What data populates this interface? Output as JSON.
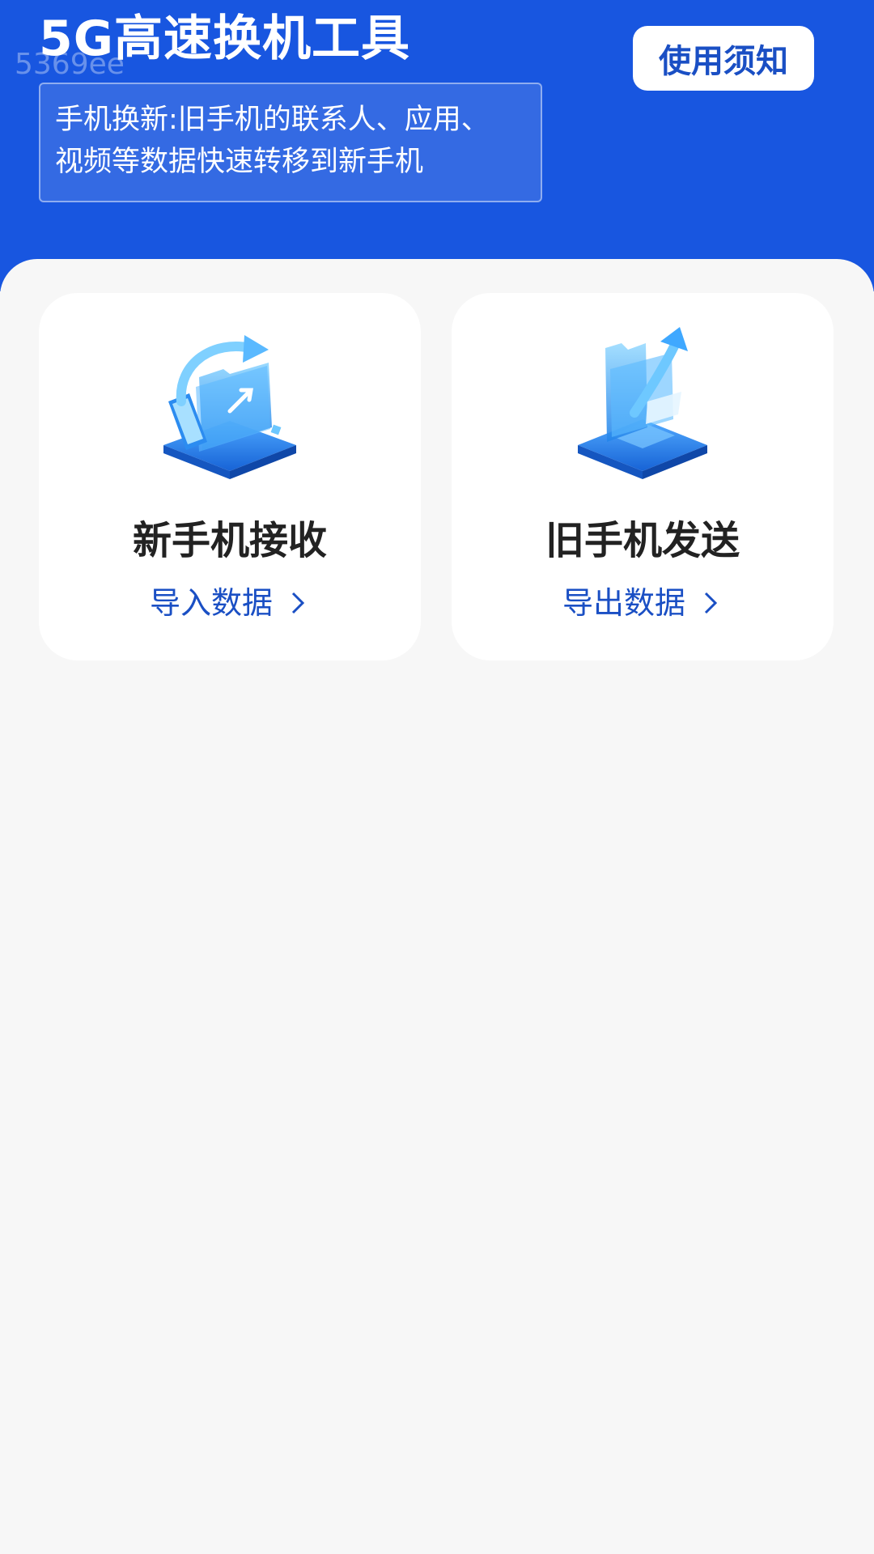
{
  "header": {
    "title": "5G高速换机工具",
    "watermark": "5369ee",
    "notice_button": "使用须知",
    "subtitle_lines": [
      "手机换新:旧手机的联系人、应用、",
      "视频等数据快速转移到新手机"
    ]
  },
  "cards": [
    {
      "title": "新手机接收",
      "action": "导入数据",
      "icon": "receive-data-illustration"
    },
    {
      "title": "旧手机发送",
      "action": "导出数据",
      "icon": "send-data-illustration"
    }
  ],
  "colors": {
    "header_bg": "#1856e0",
    "accent": "#1a4fc4",
    "page_bg": "#f7f7f7",
    "card_bg": "#ffffff"
  }
}
